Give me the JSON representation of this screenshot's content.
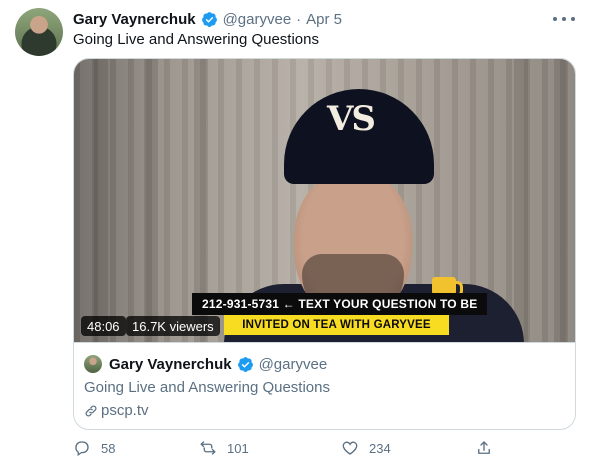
{
  "tweet": {
    "author_name": "Gary Vaynerchuk",
    "author_handle": "@garyvee",
    "separator": "·",
    "date": "Apr 5",
    "text": "Going Live and Answering Questions"
  },
  "video": {
    "cap_logo": "VS",
    "banner_line1": "212-931-5731 ← TEXT YOUR QUESTION TO BE",
    "banner_line2": "INVITED ON TEA WITH GARYVEE",
    "duration": "48:06",
    "viewers": "16.7K viewers"
  },
  "card": {
    "author_name": "Gary Vaynerchuk",
    "author_handle": "@garyvee",
    "title": "Going Live and Answering Questions",
    "link": "pscp.tv"
  },
  "actions": {
    "reply_count": "58",
    "retweet_count": "101",
    "like_count": "234"
  },
  "colors": {
    "verified": "#1d9bf0",
    "muted_text": "#5b7083",
    "banner_yellow": "#f7dc22"
  },
  "icons": [
    "verified-badge-icon",
    "more-icon",
    "link-icon",
    "reply-icon",
    "retweet-icon",
    "like-icon",
    "share-icon"
  ]
}
